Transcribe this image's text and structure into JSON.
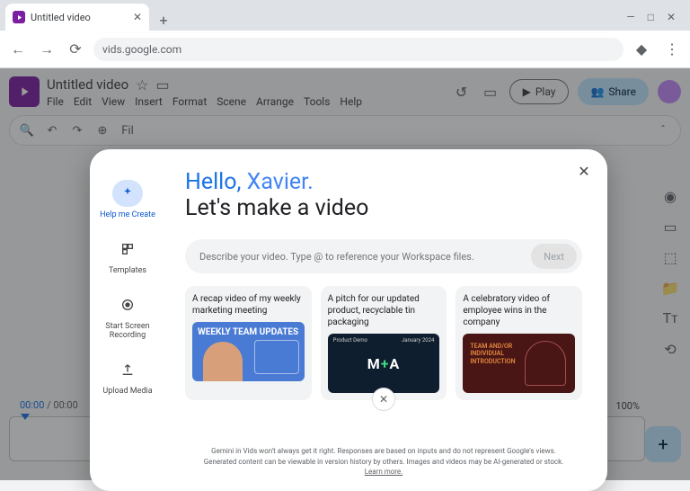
{
  "browser": {
    "tab_title": "Untitled video",
    "url": "vids.google.com"
  },
  "app": {
    "doc_title": "Untitled video",
    "menus": [
      "File",
      "Edit",
      "View",
      "Insert",
      "Format",
      "Scene",
      "Arrange",
      "Tools",
      "Help"
    ],
    "play_label": "Play",
    "share_label": "Share",
    "time_current": "00:00",
    "time_total": "00:00",
    "zoom_label": "100%"
  },
  "modal": {
    "side": [
      {
        "label": "Help me Create"
      },
      {
        "label": "Templates"
      },
      {
        "label": "Start Screen Recording"
      },
      {
        "label": "Upload Media"
      }
    ],
    "hello_prefix": "Hello, ",
    "hello_name": "Xavier.",
    "subtitle": "Let's make a video",
    "prompt_placeholder": "Describe your video. Type @ to reference your Workspace files.",
    "next_label": "Next",
    "cards": [
      {
        "title": "A recap video of my weekly marketing meeting",
        "thumb_text": "WEEKLY TEAM UPDATES"
      },
      {
        "title": "A pitch for our updated product, recyclable tin packaging",
        "thumb_text": "M+A",
        "thumb_header_left": "Product Demo",
        "thumb_header_right": "January 2024"
      },
      {
        "title": "A celebratory video of employee wins in the company",
        "thumb_text": "TEAM AND/OR\nINDIVIDUAL\nINTRODUCTION"
      }
    ],
    "disclaimer": "Gemini in Vids won't always get it right. Responses are based on inputs and do not represent Google's views. Generated content can be viewable in version history by others. Images and videos may be AI-generated or stock. ",
    "learn_more": "Learn more."
  }
}
